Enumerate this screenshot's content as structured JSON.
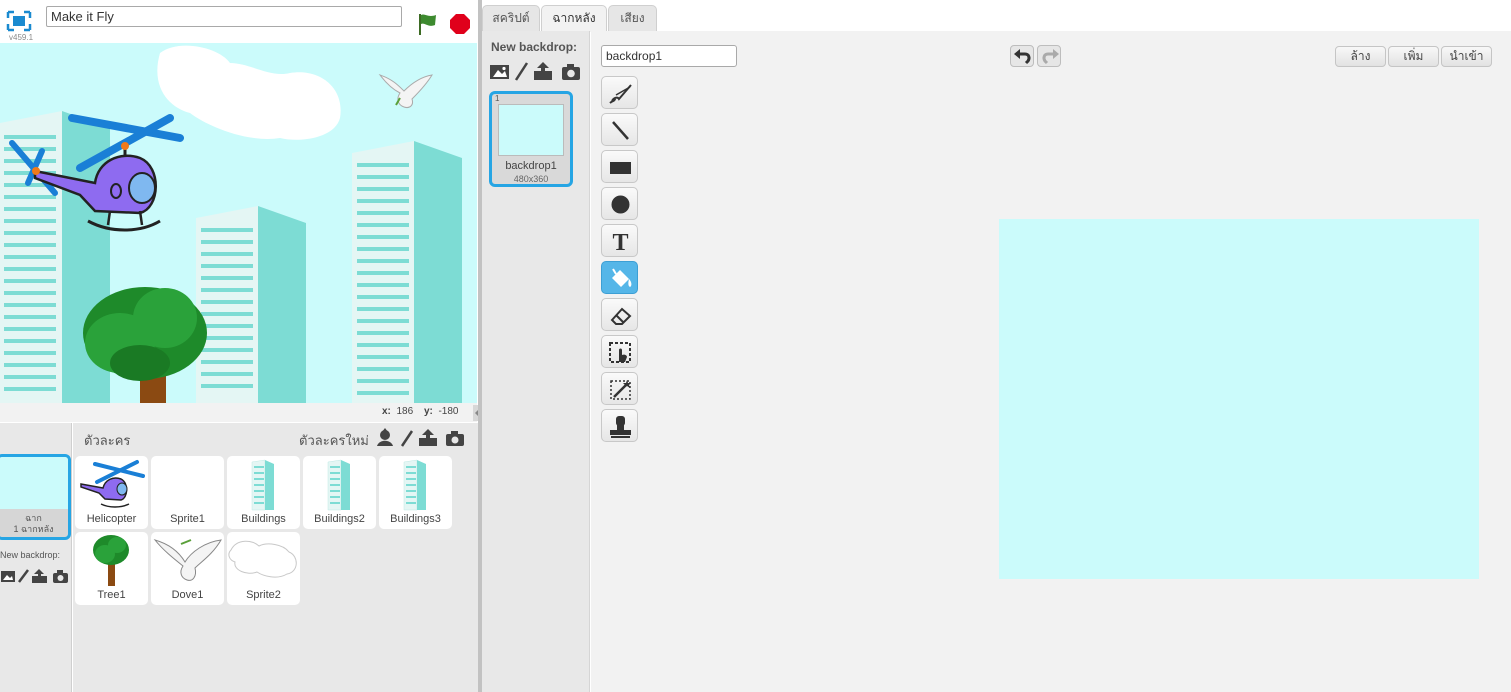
{
  "stage_header": {
    "version": "v459.1",
    "project_title": "Make it Fly"
  },
  "stage": {
    "mouse_x_label": "x:",
    "mouse_x": "186",
    "mouse_y_label": "y:",
    "mouse_y": "-180",
    "background_color": "#cbfbfb"
  },
  "stage_thumb": {
    "label_line1": "ฉาก",
    "label_line2": "1 ฉากหลัง",
    "new_backdrop_label": "New backdrop:"
  },
  "sprites_panel": {
    "title": "ตัวละคร",
    "new_sprite_label": "ตัวละครใหม่",
    "sprites": [
      {
        "name": "Helicopter",
        "icon": "helicopter-icon"
      },
      {
        "name": "Sprite1",
        "icon": "blank-icon"
      },
      {
        "name": "Buildings",
        "icon": "building-icon"
      },
      {
        "name": "Buildings2",
        "icon": "building-icon"
      },
      {
        "name": "Buildings3",
        "icon": "building-icon"
      },
      {
        "name": "Tree1",
        "icon": "tree-icon"
      },
      {
        "name": "Dove1",
        "icon": "dove-icon"
      },
      {
        "name": "Sprite2",
        "icon": "cloud-outline-icon"
      }
    ]
  },
  "tabs": [
    {
      "label": "สคริปต์",
      "active": false
    },
    {
      "label": "ฉากหลัง",
      "active": true
    },
    {
      "label": "เสียง",
      "active": false
    }
  ],
  "backdrop_list": {
    "new_backdrop_label": "New backdrop:",
    "costumes": [
      {
        "number": "1",
        "name": "backdrop1",
        "size": "480x360"
      }
    ]
  },
  "paint_editor": {
    "costume_name": "backdrop1",
    "buttons": {
      "clear": "ล้าง",
      "add": "เพิ่ม",
      "import": "นำเข้า"
    },
    "tools": [
      "brush-icon",
      "line-icon",
      "rectangle-icon",
      "ellipse-icon",
      "text-icon",
      "fill-icon",
      "eraser-icon",
      "select-icon",
      "magic-select-icon",
      "stamp-icon"
    ],
    "selected_tool": "fill-icon",
    "text_tool_glyph": "T",
    "canvas_color": "#cbfbfb"
  },
  "colors": {
    "accent": "#26a5e4",
    "selected_tool": "#55b6e8",
    "flag": "#3d8a2f",
    "stop": "#e0001b"
  }
}
